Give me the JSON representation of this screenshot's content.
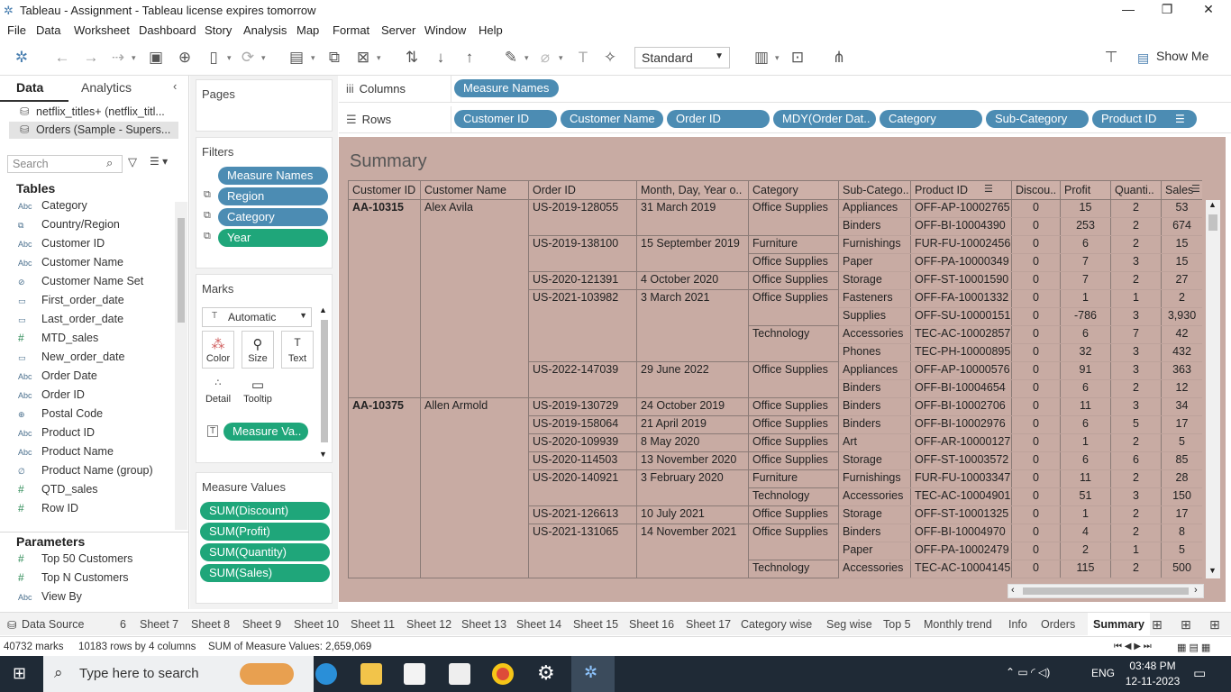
{
  "app": {
    "title": "Tableau - Assignment - Tableau license expires tomorrow"
  },
  "menu": [
    "File",
    "Data",
    "Worksheet",
    "Dashboard",
    "Story",
    "Analysis",
    "Map",
    "Format",
    "Server",
    "Window",
    "Help"
  ],
  "toolbar": {
    "fit": "Standard",
    "show_me": "Show Me"
  },
  "left": {
    "tab_data": "Data",
    "tab_analytics": "Analytics",
    "sources": [
      "netflix_titles+ (netflix_titl...",
      "Orders (Sample - Supers..."
    ],
    "search_placeholder": "Search",
    "tables_header": "Tables",
    "fields": [
      [
        "Abc",
        "Category"
      ],
      [
        "⧉",
        "Country/Region"
      ],
      [
        "Abc",
        "Customer ID"
      ],
      [
        "Abc",
        "Customer Name"
      ],
      [
        "⊘",
        "Customer Name Set"
      ],
      [
        "▭",
        "First_order_date"
      ],
      [
        "▭",
        "Last_order_date"
      ],
      [
        "#",
        "MTD_sales"
      ],
      [
        "▭",
        "New_order_date"
      ],
      [
        "Abc",
        "Order Date"
      ],
      [
        "Abc",
        "Order ID"
      ],
      [
        "⊕",
        "Postal Code"
      ],
      [
        "Abc",
        "Product ID"
      ],
      [
        "Abc",
        "Product Name"
      ],
      [
        "∅",
        "Product Name (group)"
      ],
      [
        "#",
        "QTD_sales"
      ],
      [
        "#",
        "Row ID"
      ]
    ],
    "params_header": "Parameters",
    "params": [
      [
        "#",
        "Top 50 Customers"
      ],
      [
        "#",
        "Top N Customers"
      ],
      [
        "Abc",
        "View By"
      ]
    ]
  },
  "cards": {
    "pages": "Pages",
    "filters": "Filters",
    "filter_pills": [
      "Measure Names",
      "Region",
      "Category",
      "Year"
    ],
    "marks": "Marks",
    "mark_type": "Automatic",
    "mark_btns": [
      "Color",
      "Size",
      "Text",
      "Detail",
      "Tooltip"
    ],
    "mark_pill": "Measure Va..",
    "measure_values": "Measure Values",
    "mv_pills": [
      "SUM(Discount)",
      "SUM(Profit)",
      "SUM(Quantity)",
      "SUM(Sales)"
    ]
  },
  "shelves": {
    "columns_label": "Columns",
    "rows_label": "Rows",
    "columns": [
      "Measure Names"
    ],
    "rows": [
      "Customer ID",
      "Customer Name",
      "Order ID",
      "MDY(Order Dat..",
      "Category",
      "Sub-Category",
      "Product ID"
    ]
  },
  "view": {
    "title": "Summary",
    "headers": [
      "Customer ID",
      "Customer Name",
      "Order ID",
      "Month, Day, Year o..",
      "Category",
      "Sub-Catego..",
      "Product ID",
      "Discou..",
      "Profit",
      "Quanti..",
      "Sales"
    ],
    "rows": [
      [
        "AA-10315",
        "Alex Avila",
        "US-2019-128055",
        "31 March 2019",
        "Office Supplies",
        "Appliances",
        "OFF-AP-10002765",
        "0",
        "15",
        "2",
        "53"
      ],
      [
        "",
        "",
        "",
        "",
        "",
        "Binders",
        "OFF-BI-10004390",
        "0",
        "253",
        "2",
        "674"
      ],
      [
        "",
        "",
        "US-2019-138100",
        "15 September 2019",
        "Furniture",
        "Furnishings",
        "FUR-FU-10002456",
        "0",
        "6",
        "2",
        "15"
      ],
      [
        "",
        "",
        "",
        "",
        "Office Supplies",
        "Paper",
        "OFF-PA-10000349",
        "0",
        "7",
        "3",
        "15"
      ],
      [
        "",
        "",
        "US-2020-121391",
        "4 October 2020",
        "Office Supplies",
        "Storage",
        "OFF-ST-10001590",
        "0",
        "7",
        "2",
        "27"
      ],
      [
        "",
        "",
        "US-2021-103982",
        "3 March 2021",
        "Office Supplies",
        "Fasteners",
        "OFF-FA-10001332",
        "0",
        "1",
        "1",
        "2"
      ],
      [
        "",
        "",
        "",
        "",
        "",
        "Supplies",
        "OFF-SU-10000151",
        "0",
        "-786",
        "3",
        "3,930"
      ],
      [
        "",
        "",
        "",
        "",
        "Technology",
        "Accessories",
        "TEC-AC-10002857",
        "0",
        "6",
        "7",
        "42"
      ],
      [
        "",
        "",
        "",
        "",
        "",
        "Phones",
        "TEC-PH-10000895",
        "0",
        "32",
        "3",
        "432"
      ],
      [
        "",
        "",
        "US-2022-147039",
        "29 June 2022",
        "Office Supplies",
        "Appliances",
        "OFF-AP-10000576",
        "0",
        "91",
        "3",
        "363"
      ],
      [
        "",
        "",
        "",
        "",
        "",
        "Binders",
        "OFF-BI-10004654",
        "0",
        "6",
        "2",
        "12"
      ],
      [
        "AA-10375",
        "Allen Armold",
        "US-2019-130729",
        "24 October 2019",
        "Office Supplies",
        "Binders",
        "OFF-BI-10002706",
        "0",
        "11",
        "3",
        "34"
      ],
      [
        "",
        "",
        "US-2019-158064",
        "21 April 2019",
        "Office Supplies",
        "Binders",
        "OFF-BI-10002976",
        "0",
        "6",
        "5",
        "17"
      ],
      [
        "",
        "",
        "US-2020-109939",
        "8 May 2020",
        "Office Supplies",
        "Art",
        "OFF-AR-10000127",
        "0",
        "1",
        "2",
        "5"
      ],
      [
        "",
        "",
        "US-2020-114503",
        "13 November 2020",
        "Office Supplies",
        "Storage",
        "OFF-ST-10003572",
        "0",
        "6",
        "6",
        "85"
      ],
      [
        "",
        "",
        "US-2020-140921",
        "3 February 2020",
        "Furniture",
        "Furnishings",
        "FUR-FU-10003347",
        "0",
        "11",
        "2",
        "28"
      ],
      [
        "",
        "",
        "",
        "",
        "Technology",
        "Accessories",
        "TEC-AC-10004901",
        "0",
        "51",
        "3",
        "150"
      ],
      [
        "",
        "",
        "US-2021-126613",
        "10 July 2021",
        "Office Supplies",
        "Storage",
        "OFF-ST-10001325",
        "0",
        "1",
        "2",
        "17"
      ],
      [
        "",
        "",
        "US-2021-131065",
        "14 November 2021",
        "Office Supplies",
        "Binders",
        "OFF-BI-10004970",
        "0",
        "4",
        "2",
        "8"
      ],
      [
        "",
        "",
        "",
        "",
        "",
        "Paper",
        "OFF-PA-10002479",
        "0",
        "2",
        "1",
        "5"
      ],
      [
        "",
        "",
        "",
        "",
        "Technology",
        "Accessories",
        "TEC-AC-10004145",
        "0",
        "115",
        "2",
        "500"
      ]
    ]
  },
  "sheet_tabs": [
    "Data Source",
    "6",
    "Sheet 7",
    "Sheet 8",
    "Sheet 9",
    "Sheet 10",
    "Sheet 11",
    "Sheet 12",
    "Sheet 13",
    "Sheet 14",
    "Sheet 15",
    "Sheet 16",
    "Sheet 17",
    "Category wise",
    "Seg wise",
    "Top 5",
    "Monthly trend",
    "Info",
    "Orders",
    "Summary"
  ],
  "status": {
    "marks": "40732 marks",
    "rows": "10183 rows by 4 columns",
    "sum": "SUM of Measure Values: 2,659,069"
  },
  "taskbar": {
    "search": "Type here to search",
    "lang": "ENG",
    "time": "03:48 PM",
    "date": "12-11-2023"
  }
}
